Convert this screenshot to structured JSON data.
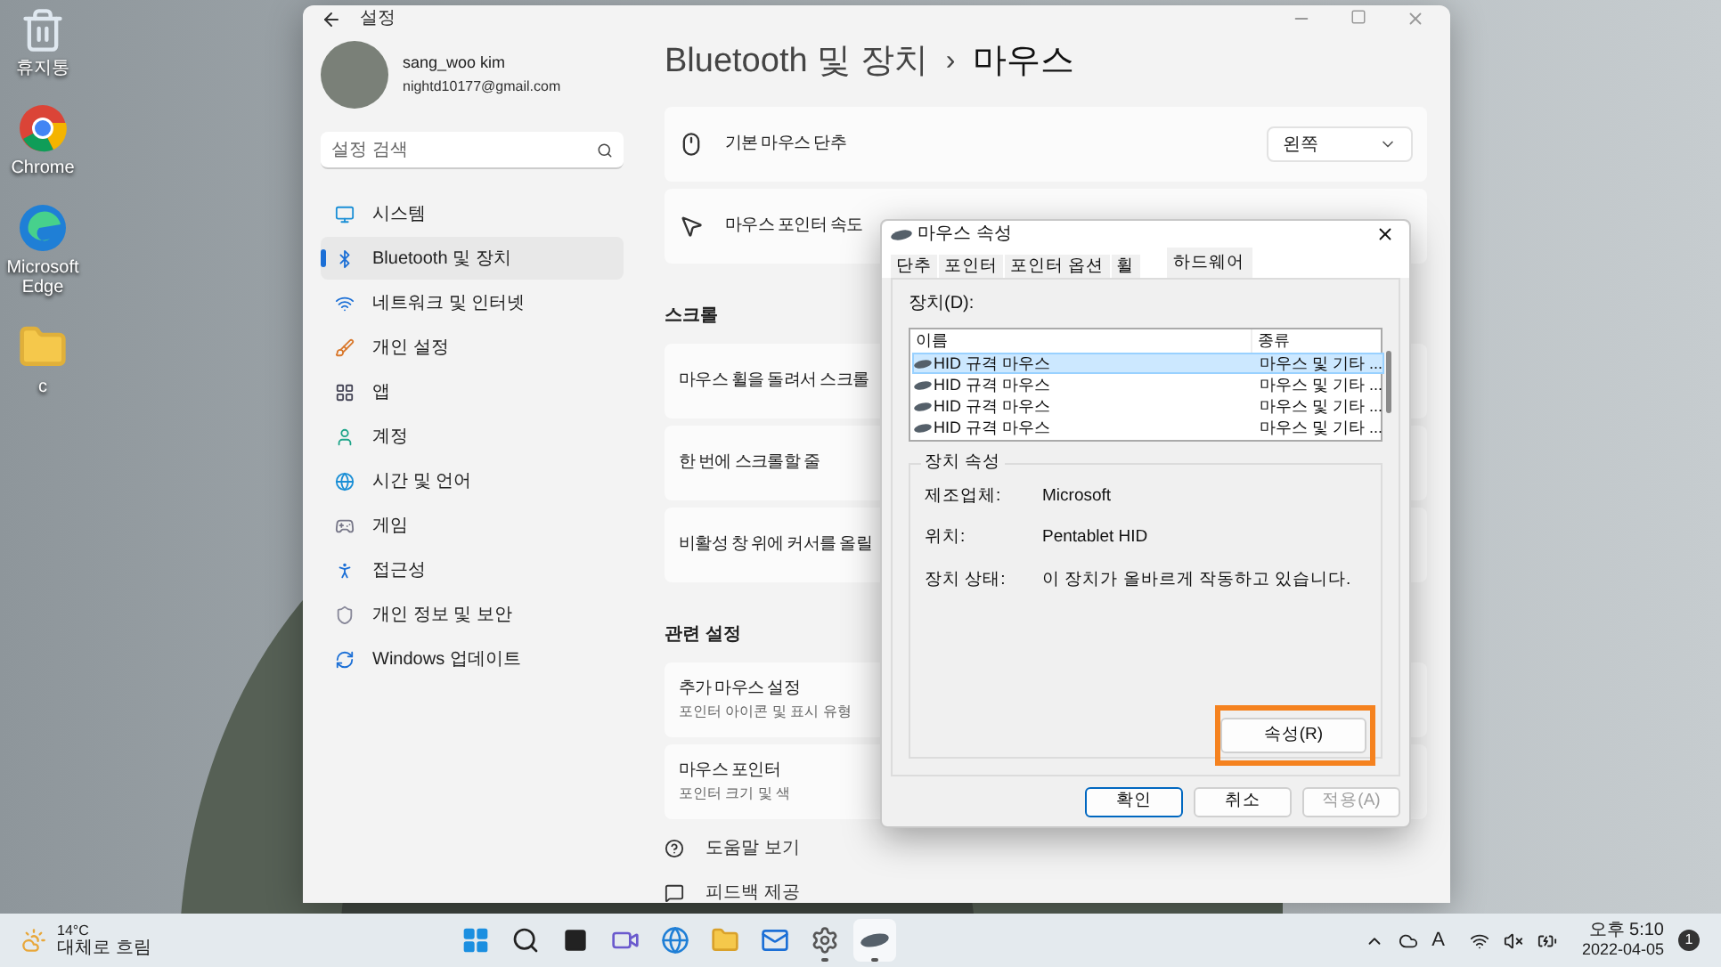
{
  "desktop_icons": [
    {
      "kind": "recycle",
      "label": "휴지통"
    },
    {
      "kind": "chrome",
      "label": "Chrome"
    },
    {
      "kind": "edge",
      "label": "Microsoft Edge"
    },
    {
      "kind": "folder",
      "label": "c"
    }
  ],
  "settings": {
    "title": "설정",
    "user": {
      "name": "sang_woo kim",
      "email": "nightd10177@gmail.com"
    },
    "search": {
      "placeholder": "설정 검색"
    },
    "nav": [
      {
        "kind": "system",
        "label": "시스템",
        "selected": false
      },
      {
        "kind": "bluetooth",
        "label": "Bluetooth 및 장치",
        "selected": true
      },
      {
        "kind": "network",
        "label": "네트워크 및 인터넷",
        "selected": false
      },
      {
        "kind": "personalize",
        "label": "개인 설정",
        "selected": false
      },
      {
        "kind": "apps",
        "label": "앱",
        "selected": false
      },
      {
        "kind": "accounts",
        "label": "계정",
        "selected": false
      },
      {
        "kind": "time",
        "label": "시간 및 언어",
        "selected": false
      },
      {
        "kind": "gaming",
        "label": "게임",
        "selected": false
      },
      {
        "kind": "accessibility",
        "label": "접근성",
        "selected": false
      },
      {
        "kind": "privacy",
        "label": "개인 정보 및 보안",
        "selected": false
      },
      {
        "kind": "update",
        "label": "Windows 업데이트",
        "selected": false
      }
    ],
    "breadcrumb": {
      "parent": "Bluetooth 및 장치",
      "separator": "›",
      "current": "마우스"
    },
    "content": [
      {
        "kind": "mouse",
        "label": "기본 마우스 단추",
        "dropdown": "왼쪽"
      },
      {
        "kind": "pointer",
        "label": "마우스 포인터 속도"
      },
      {
        "kind": "header",
        "label": "스크롤"
      },
      {
        "kind": "row",
        "label": "마우스 휠을 돌려서 스크롤"
      },
      {
        "kind": "row",
        "label": "한 번에 스크롤할 줄"
      },
      {
        "kind": "row",
        "label": "비활성 창 위에 커서를 올릴"
      },
      {
        "kind": "header",
        "label": "관련 설정"
      },
      {
        "kind": "row",
        "label": "추가 마우스 설정",
        "sublabel": "포인터 아이콘 및 표시 유형"
      },
      {
        "kind": "row",
        "label": "마우스 포인터",
        "sublabel": "포인터 크기 및 색"
      },
      {
        "kind": "help",
        "label": "도움말 보기"
      },
      {
        "kind": "feedback",
        "label": "피드백 제공"
      }
    ]
  },
  "dialog": {
    "title": "마우스 속성",
    "tabs": [
      {
        "label": "단추",
        "selected": false
      },
      {
        "label": "포인터",
        "selected": false
      },
      {
        "label": "포인터 옵션",
        "selected": false
      },
      {
        "label": "휠",
        "selected": false
      },
      {
        "label": "하드웨어",
        "selected": true
      }
    ],
    "devices_label": "장치(D):",
    "columns": [
      "이름",
      "종류"
    ],
    "rows": [
      {
        "name": "HID 규격 마우스",
        "type": "마우스 및 기타 ...",
        "selected": true
      },
      {
        "name": "HID 규격 마우스",
        "type": "마우스 및 기타 ...",
        "selected": false
      },
      {
        "name": "HID 규격 마우스",
        "type": "마우스 및 기타 ...",
        "selected": false
      },
      {
        "name": "HID 규격 마우스",
        "type": "마우스 및 기타 ...",
        "selected": false
      }
    ],
    "group_title": "장치 속성",
    "properties": [
      {
        "label": "제조업체:",
        "value": "Microsoft"
      },
      {
        "label": "위치:",
        "value": "Pentablet HID"
      },
      {
        "label": "장치 상태:",
        "value": "이 장치가 올바르게 작동하고 있습니다."
      }
    ],
    "properties_button": {
      "label": "속성(R)",
      "highlighted": true
    },
    "buttons": [
      {
        "label": "확인",
        "default": true,
        "disabled": false
      },
      {
        "label": "취소",
        "default": false,
        "disabled": false
      },
      {
        "label": "적용(A)",
        "default": false,
        "disabled": true
      }
    ]
  },
  "taskbar": {
    "weather": {
      "temperature": "14°C",
      "condition": "대체로 흐림"
    },
    "apps": [
      {
        "kind": "start",
        "running": false
      },
      {
        "kind": "search",
        "running": false
      },
      {
        "kind": "taskview",
        "running": false
      },
      {
        "kind": "chat",
        "running": false
      },
      {
        "kind": "edge",
        "running": false
      },
      {
        "kind": "explorer",
        "running": false
      },
      {
        "kind": "mail",
        "running": false
      },
      {
        "kind": "settings",
        "running": true
      },
      {
        "kind": "mouse",
        "running": true
      }
    ],
    "input_indicator": "A",
    "time": "오후 5:10",
    "date": "2022-04-05",
    "notification_count": "1"
  }
}
